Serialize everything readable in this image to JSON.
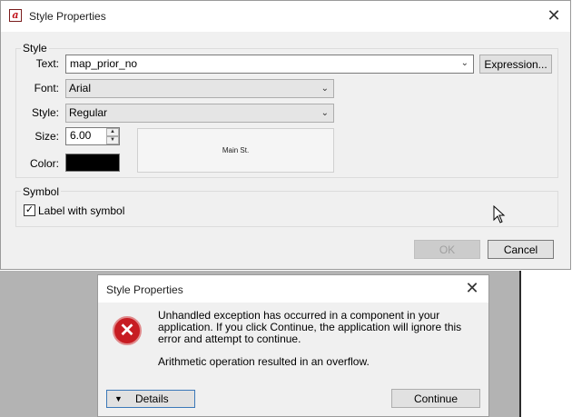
{
  "main_dialog": {
    "title": "Style Properties",
    "style_group": {
      "label": "Style",
      "text_label": "Text:",
      "text_value": "map_prior_no",
      "expression_button": "Expression...",
      "font_label": "Font:",
      "font_value": "Arial",
      "style_label": "Style:",
      "style_value": "Regular",
      "size_label": "Size:",
      "size_value": "6.00",
      "color_label": "Color:",
      "color_value": "#000000",
      "preview_text": "Main St."
    },
    "symbol_group": {
      "label": "Symbol",
      "label_with_symbol": "Label with symbol",
      "label_with_symbol_checked": true
    },
    "ok_button": "OK",
    "cancel_button": "Cancel"
  },
  "error_dialog": {
    "title": "Style Properties",
    "message": "Unhandled exception has occurred in a component in your application. If you click Continue, the application will ignore this error and attempt to continue.",
    "detail": "Arithmetic operation resulted in an overflow.",
    "details_button": "Details",
    "continue_button": "Continue",
    "icon": "error-icon"
  }
}
